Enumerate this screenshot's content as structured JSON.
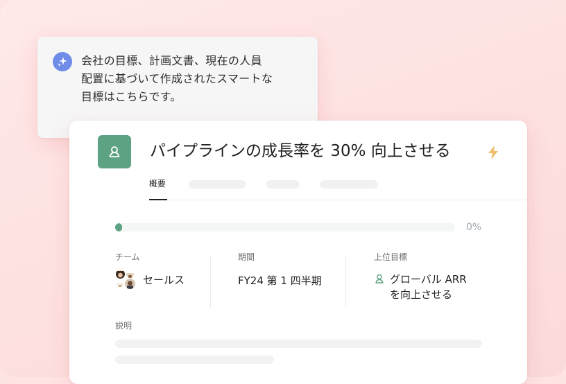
{
  "ai_message": {
    "icon": "sparkles-icon",
    "lines": [
      "会社の目標、計画文書、現在の人員",
      "配置に基づいて作成されたスマートな",
      "目標はこちらです。"
    ]
  },
  "goal": {
    "icon": "goal-person-icon",
    "title": "パイプラインの成長率を 30% 向上させる",
    "title_icon": "lightning-bolt-icon",
    "tabs": {
      "overview": "概要"
    },
    "progress": {
      "value": 0.02,
      "label": "0%"
    },
    "team": {
      "label": "チーム",
      "value": "セールス"
    },
    "period": {
      "label": "期間",
      "value": "FY24 第 1 四半期"
    },
    "parent_goal": {
      "label": "上位目標",
      "lines": [
        "グローバル ARR",
        "を向上させる"
      ]
    },
    "description": {
      "label": "説明"
    }
  },
  "colors": {
    "background": "#ffe4e4",
    "accent_green": "#5da283",
    "ai_blue": "#6f8de8",
    "bolt": "#f1bd6c"
  }
}
